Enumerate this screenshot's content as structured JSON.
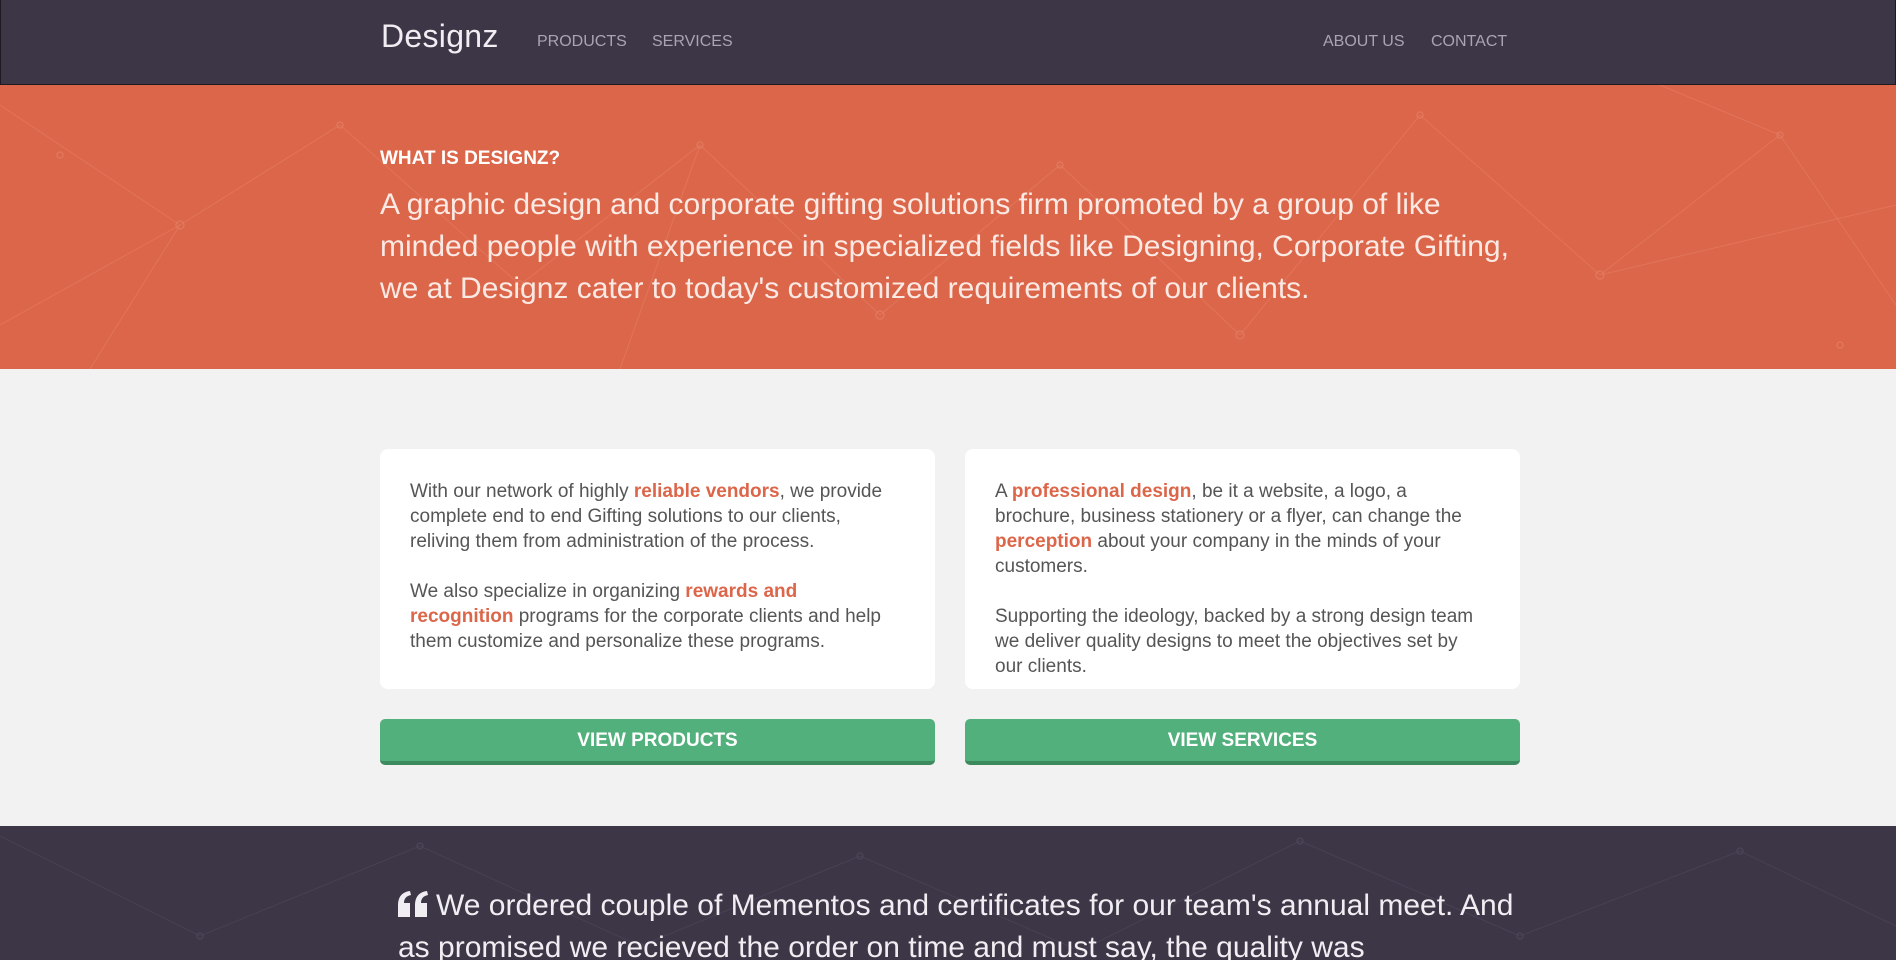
{
  "nav": {
    "brand": "Designz",
    "left_links": [
      "PRODUCTS",
      "SERVICES"
    ],
    "right_links": [
      "ABOUT US",
      "CONTACT"
    ]
  },
  "hero": {
    "kicker": "WHAT IS DESIGNZ?",
    "text": "A graphic design and corporate gifting solutions firm promoted by a group of like minded people with experience in specialized fields like Designing, Corporate Gifting, we at Designz cater to today's customized requirements of our clients."
  },
  "cards": [
    {
      "p1_before": "With our network of highly ",
      "p1_highlight": "reliable vendors",
      "p1_after": ", we provide complete end to end Gifting solutions to our clients, reliving them from administration of the process.",
      "p2_before": "We also specialize in organizing ",
      "p2_highlight": "rewards and recognition",
      "p2_after": " programs for the corporate clients and help them customize and personalize these programs.",
      "button": "VIEW PRODUCTS"
    },
    {
      "p1_before": "A ",
      "p1_highlight": "professional design",
      "p1_middle": ", be it a website, a logo, a brochure, business stationery or a flyer, can change the ",
      "p1_highlight2": "perception",
      "p1_after": " about your company in the minds of your customers.",
      "p2_text": "Supporting the ideology, backed by a strong design team we deliver quality designs to meet the objectives set by our clients.",
      "button": "VIEW SERVICES"
    }
  ],
  "testimonial": {
    "icon": "quote-left-icon",
    "text": "We ordered couple of Mementos and certificates for our team's annual meet. And as promised we recieved the order on time and must say, the quality was impeccable. Their"
  },
  "colors": {
    "navbar": "#3d3647",
    "accent": "#dc664a",
    "button": "#52b07c",
    "page_bg": "#f2f2f2"
  }
}
